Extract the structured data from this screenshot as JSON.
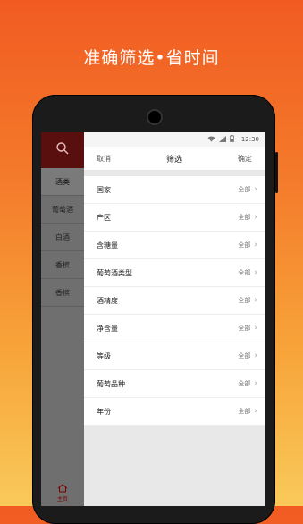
{
  "headline": "准确筛选•省时间",
  "statusbar": {
    "time": "12:30"
  },
  "nav": {
    "items": [
      {
        "label": "酒类",
        "active": true
      },
      {
        "label": "葡萄酒",
        "active": false
      },
      {
        "label": "白酒",
        "active": false
      },
      {
        "label": "香槟",
        "active": false
      },
      {
        "label": "香槟",
        "active": false
      }
    ],
    "home_label": "主页",
    "search_icon": "search-icon",
    "home_icon": "home-icon"
  },
  "filter": {
    "cancel": "取消",
    "title": "筛选",
    "confirm": "确定",
    "rows": [
      {
        "label": "国家",
        "value": "全部"
      },
      {
        "label": "产区",
        "value": "全部"
      },
      {
        "label": "含糖量",
        "value": "全部"
      },
      {
        "label": "葡萄酒类型",
        "value": "全部"
      },
      {
        "label": "酒精度",
        "value": "全部"
      },
      {
        "label": "净含量",
        "value": "全部"
      },
      {
        "label": "等级",
        "value": "全部"
      },
      {
        "label": "葡萄品种",
        "value": "全部"
      },
      {
        "label": "年份",
        "value": "全部"
      }
    ]
  },
  "colors": {
    "accent": "#f15b22",
    "nav_top": "#5a0f0f"
  }
}
